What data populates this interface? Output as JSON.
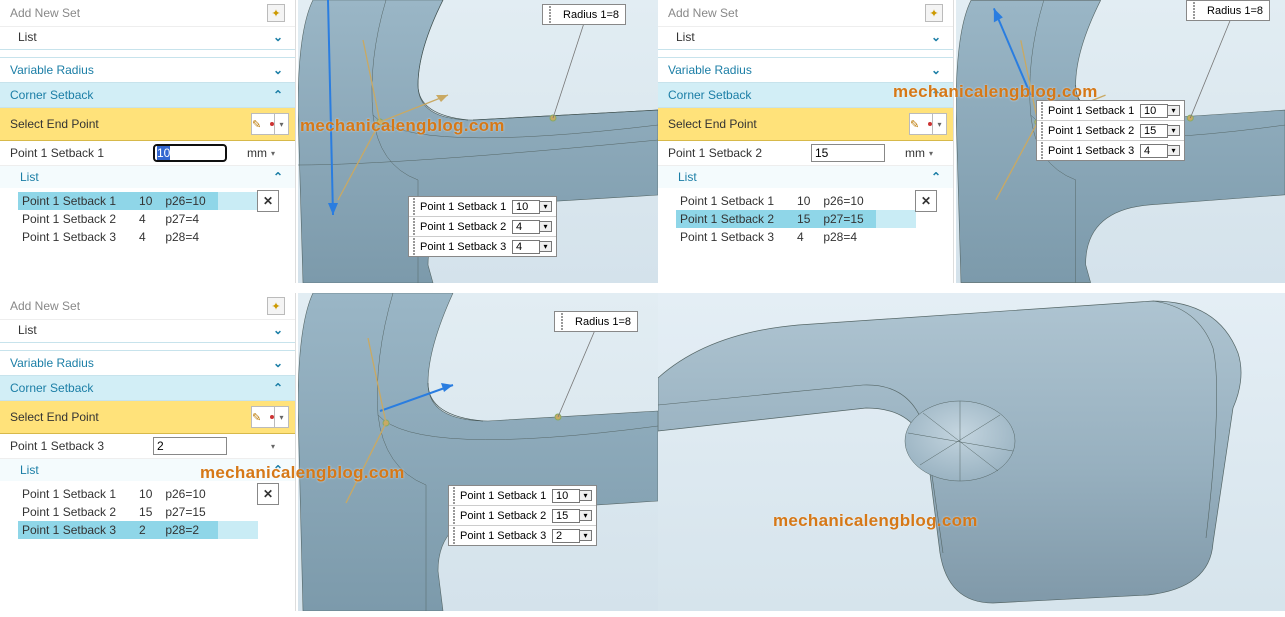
{
  "common": {
    "add_new_set": "Add New Set",
    "list": "List",
    "variable_radius": "Variable Radius",
    "corner_setback": "Corner Setback",
    "select_end_point": "Select End Point",
    "unit": "mm",
    "radius_label": "Radius 1=8",
    "watermark": "mechanicalengblog.com",
    "setback_names": [
      "Point 1 Setback 1",
      "Point 1 Setback 2",
      "Point 1 Setback 3"
    ]
  },
  "q1": {
    "param_label": "Point 1 Setback 1",
    "param_value": "10",
    "table": [
      {
        "name": "Point 1 Setback 1",
        "val": "10",
        "expr": "p26=10",
        "sel": true
      },
      {
        "name": "Point 1 Setback 2",
        "val": "4",
        "expr": "p27=4",
        "sel": false
      },
      {
        "name": "Point 1 Setback 3",
        "val": "4",
        "expr": "p28=4",
        "sel": false
      }
    ],
    "float": [
      {
        "name": "Point 1 Setback 1",
        "val": "10"
      },
      {
        "name": "Point 1 Setback 2",
        "val": "4"
      },
      {
        "name": "Point 1 Setback 3",
        "val": "4"
      }
    ]
  },
  "q2": {
    "param_label": "Point 1 Setback 2",
    "param_value": "15",
    "table": [
      {
        "name": "Point 1 Setback 1",
        "val": "10",
        "expr": "p26=10",
        "sel": false
      },
      {
        "name": "Point 1 Setback 2",
        "val": "15",
        "expr": "p27=15",
        "sel": true
      },
      {
        "name": "Point 1 Setback 3",
        "val": "4",
        "expr": "p28=4",
        "sel": false
      }
    ],
    "float": [
      {
        "name": "Point 1 Setback 1",
        "val": "10"
      },
      {
        "name": "Point 1 Setback 2",
        "val": "15"
      },
      {
        "name": "Point 1 Setback 3",
        "val": "4"
      }
    ]
  },
  "q3": {
    "param_label": "Point 1 Setback 3",
    "param_value": "2",
    "table": [
      {
        "name": "Point 1 Setback 1",
        "val": "10",
        "expr": "p26=10",
        "sel": false
      },
      {
        "name": "Point 1 Setback 2",
        "val": "15",
        "expr": "p27=15",
        "sel": false
      },
      {
        "name": "Point 1 Setback 3",
        "val": "2",
        "expr": "p28=2",
        "sel": true
      }
    ],
    "float": [
      {
        "name": "Point 1 Setback 1",
        "val": "10"
      },
      {
        "name": "Point 1 Setback 2",
        "val": "15"
      },
      {
        "name": "Point 1 Setback 3",
        "val": "2"
      }
    ]
  }
}
